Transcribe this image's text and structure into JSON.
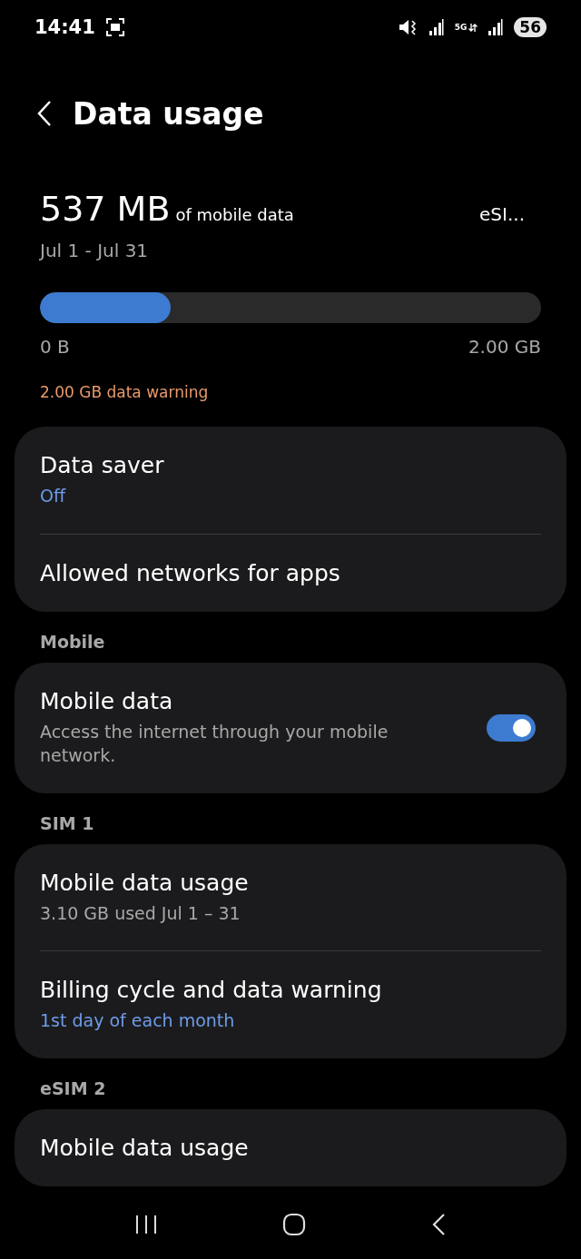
{
  "status_bar": {
    "time": "14:41",
    "network": "5G",
    "battery": "56"
  },
  "header": {
    "title": "Data usage"
  },
  "summary": {
    "amount": "537 MB",
    "amount_suffix": "of mobile data",
    "sim": "eSI...",
    "period": "Jul 1 - Jul 31",
    "level": 0.26,
    "min_label": "0 B",
    "max_label": "2.00 GB",
    "warning": "2.00 GB data warning"
  },
  "sections": [
    {
      "rows": [
        {
          "kind": "text",
          "title": "Data saver",
          "subtitle": "Off",
          "subtitle_accent": true
        },
        {
          "kind": "text",
          "title": "Allowed networks for apps"
        }
      ]
    },
    {
      "header": "Mobile",
      "rows": [
        {
          "kind": "toggle",
          "title": "Mobile data",
          "subtitle": "Access the internet through your mobile network.",
          "on": true
        }
      ]
    },
    {
      "header": "SIM 1",
      "rows": [
        {
          "kind": "text",
          "title": "Mobile data usage",
          "subtitle": "3.10 GB used Jul 1 – 31",
          "subtitle_accent": false
        },
        {
          "kind": "text",
          "title": "Billing cycle and data warning",
          "subtitle": "1st day of each month",
          "subtitle_accent": true
        }
      ]
    },
    {
      "header": "eSIM 2",
      "rows": [
        {
          "kind": "text",
          "title": "Mobile data usage"
        }
      ]
    }
  ]
}
